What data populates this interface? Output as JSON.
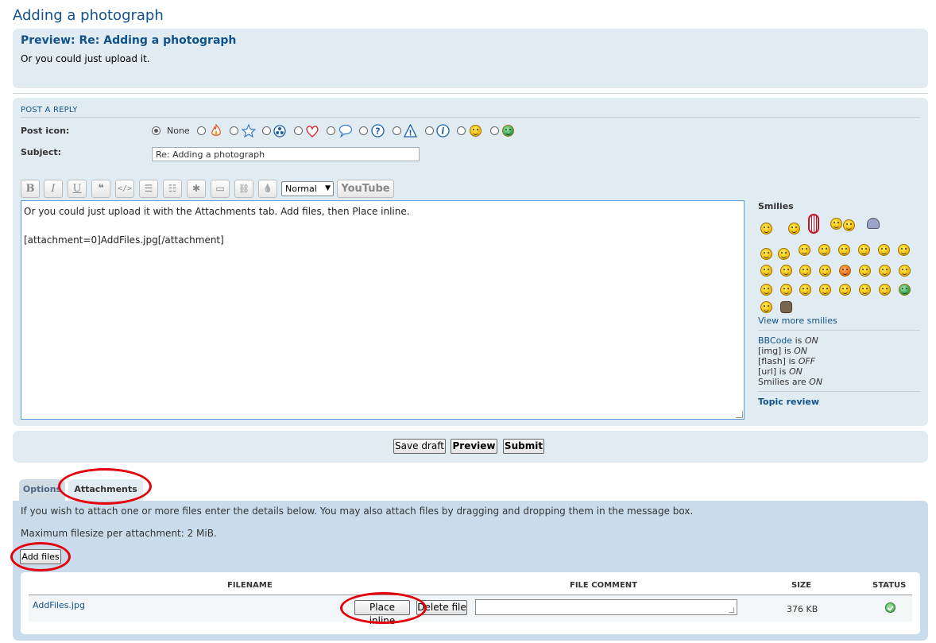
{
  "page": {
    "title": "Adding a photograph"
  },
  "preview": {
    "title": "Preview: Re: Adding a photograph",
    "body": "Or you could just upload it."
  },
  "form": {
    "section_title": "POST A REPLY",
    "post_icon_label": "Post icon:",
    "post_icon_none": "None",
    "post_icons": [
      "fire-icon",
      "star-icon",
      "radioactive-icon",
      "heart-icon",
      "speech-bubble-icon",
      "question-icon",
      "warning-icon",
      "info-icon",
      "wink-smiley-icon",
      "grin-smiley-icon"
    ],
    "subject_label": "Subject:",
    "subject_value": "Re: Adding a photograph"
  },
  "toolbar": {
    "bold": "B",
    "italic": "I",
    "underline": "U",
    "quote": "❝",
    "code": "</>",
    "list": "☰",
    "list_ordered": "☷",
    "list_item": "✱",
    "image": "▭",
    "url": "⛓",
    "color": "💧",
    "font_size": "Normal",
    "youtube": "YouTube"
  },
  "editor": {
    "content": "Or you could just upload it with the Attachments tab. Add files, then Place inline.\n\n[attachment=0]AddFiles.jpg[/attachment]"
  },
  "sidebar": {
    "smilies_title": "Smilies",
    "view_more": "View more smilies",
    "bbcode": {
      "label": "BBCode",
      "is": "is",
      "value": "ON"
    },
    "img": {
      "label": "[img]",
      "is": "is",
      "value": "ON"
    },
    "flash": {
      "label": "[flash]",
      "is": "is",
      "value": "OFF"
    },
    "url": {
      "label": "[url]",
      "is": "is",
      "value": "ON"
    },
    "smilies_status": {
      "label": "Smilies",
      "is": "are",
      "value": "ON"
    },
    "topic_review": "Topic review"
  },
  "actions": {
    "save_draft": "Save draft",
    "preview": "Preview",
    "submit": "Submit"
  },
  "tabs": {
    "options": "Options",
    "attachments": "Attachments"
  },
  "attachments": {
    "info": "If you wish to attach one or more files enter the details below. You may also attach files by dragging and dropping them in the message box.",
    "max_size": "Maximum filesize per attachment: 2 MiB.",
    "add_files": "Add files",
    "headers": {
      "filename": "FILENAME",
      "comment": "FILE COMMENT",
      "size": "SIZE",
      "status": "STATUS"
    },
    "file": {
      "name": "AddFiles.jpg",
      "place_inline": "Place inline",
      "delete": "Delete file",
      "comment": "",
      "size": "376 KB",
      "status": "ok"
    }
  },
  "colors": {
    "title": "#105289",
    "panel": "#e1ebf2",
    "attach_panel": "#cadceb",
    "highlight_ring": "#e3000b"
  }
}
